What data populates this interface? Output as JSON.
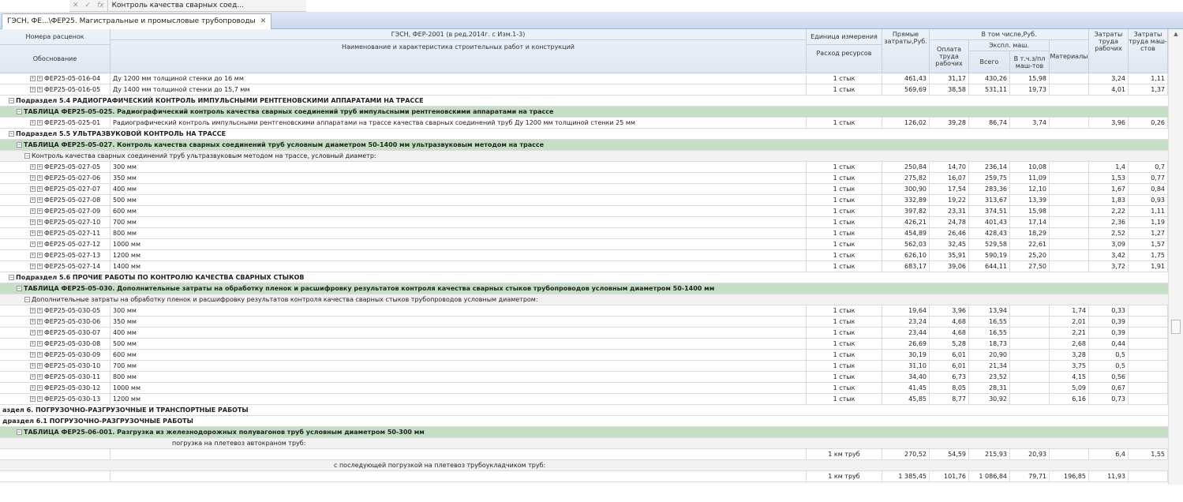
{
  "formula_bar": {
    "cancel": "✕",
    "confirm": "✓",
    "fx": "fx",
    "text": "Контроль качества сварных соед..."
  },
  "tab": {
    "label": "ГЭСН, ФЕ...\\ФЕР25. Магистральные и промысловые трубопроводы",
    "close": "✕"
  },
  "header": {
    "code_top": "Номера расценок",
    "code_bottom": "Обоснование",
    "title": "ГЭСН, ФЕР-2001 (в ред.2014г. с Изм.1-3)",
    "name": "Наименование и характеристика строительных работ и конструкций",
    "unit_top": "Единица измерения",
    "unit_bottom": "Расход ресурсов",
    "direct": "Прямые затраты,Руб.",
    "incl": "В том числе,Руб.",
    "pay": "Оплата труда рабочих",
    "mach": "Экспл. маш.",
    "mach_total": "Всего",
    "mach_incl": "В т.ч.з/пл маш-тов",
    "materials": "Материалы",
    "labor": "Затраты труда рабочих",
    "labor_mach": "Затраты труда маш-стов"
  },
  "rows": [
    {
      "type": "item",
      "code": "ФЕР25-05-016-04",
      "name": "Ду 1200 мм толщиной стенки до 16 мм",
      "unit": "1 стык",
      "v": [
        "461,43",
        "31,17",
        "430,26",
        "15,98",
        "",
        "3,24",
        "1,11"
      ]
    },
    {
      "type": "item",
      "code": "ФЕР25-05-016-05",
      "name": "Ду 1400 мм толщиной стенки до 15,7 мм",
      "unit": "1 стык",
      "v": [
        "569,69",
        "38,58",
        "531,11",
        "19,73",
        "",
        "4,01",
        "1,37"
      ]
    },
    {
      "type": "section",
      "text": "Подраздел 5.4 РАДИОГРАФИЧЕСКИЙ КОНТРОЛЬ ИМПУЛЬСНЫМИ РЕНТГЕНОВСКИМИ АППАРАТАМИ НА ТРАССЕ"
    },
    {
      "type": "table",
      "text": "ТАБЛИЦА ФЕР25-05-025. Радиографический контроль качества сварных соединений труб импульсными рентгеновскими аппаратами на трассе"
    },
    {
      "type": "item",
      "code": "ФЕР25-05-025-01",
      "name": "Радиографический контроль импульсными рентгеновскими аппаратами на трассе качества сварных соединений труб Ду 1200 мм толщиной стенки 25 мм",
      "unit": "1 стык",
      "v": [
        "126,02",
        "39,28",
        "86,74",
        "3,74",
        "",
        "3,96",
        "0,26"
      ]
    },
    {
      "type": "section",
      "text": "Подраздел 5.5 УЛЬТРАЗВУКОВОЙ КОНТРОЛЬ НА ТРАССЕ"
    },
    {
      "type": "table",
      "text": "ТАБЛИЦА ФЕР25-05-027. Контроль качества сварных соединений труб условным диаметром 50-1400 мм ультразвуковым методом на трассе"
    },
    {
      "type": "group",
      "text": "Контроль качества сварных соединений труб ультразвуковым методом на трассе, условный диаметр:"
    },
    {
      "type": "item",
      "code": "ФЕР25-05-027-05",
      "name": "300 мм",
      "unit": "1 стык",
      "v": [
        "250,84",
        "14,70",
        "236,14",
        "10,08",
        "",
        "1,4",
        "0,7"
      ]
    },
    {
      "type": "item",
      "code": "ФЕР25-05-027-06",
      "name": "350 мм",
      "unit": "1 стык",
      "v": [
        "275,82",
        "16,07",
        "259,75",
        "11,09",
        "",
        "1,53",
        "0,77"
      ]
    },
    {
      "type": "item",
      "code": "ФЕР25-05-027-07",
      "name": "400 мм",
      "unit": "1 стык",
      "v": [
        "300,90",
        "17,54",
        "283,36",
        "12,10",
        "",
        "1,67",
        "0,84"
      ]
    },
    {
      "type": "item",
      "code": "ФЕР25-05-027-08",
      "name": "500 мм",
      "unit": "1 стык",
      "v": [
        "332,89",
        "19,22",
        "313,67",
        "13,39",
        "",
        "1,83",
        "0,93"
      ]
    },
    {
      "type": "item",
      "code": "ФЕР25-05-027-09",
      "name": "600 мм",
      "unit": "1 стык",
      "v": [
        "397,82",
        "23,31",
        "374,51",
        "15,98",
        "",
        "2,22",
        "1,11"
      ]
    },
    {
      "type": "item",
      "code": "ФЕР25-05-027-10",
      "name": "700 мм",
      "unit": "1 стык",
      "v": [
        "426,21",
        "24,78",
        "401,43",
        "17,14",
        "",
        "2,36",
        "1,19"
      ]
    },
    {
      "type": "item",
      "code": "ФЕР25-05-027-11",
      "name": "800 мм",
      "unit": "1 стык",
      "v": [
        "454,89",
        "26,46",
        "428,43",
        "18,29",
        "",
        "2,52",
        "1,27"
      ]
    },
    {
      "type": "item",
      "code": "ФЕР25-05-027-12",
      "name": "1000 мм",
      "unit": "1 стык",
      "v": [
        "562,03",
        "32,45",
        "529,58",
        "22,61",
        "",
        "3,09",
        "1,57"
      ]
    },
    {
      "type": "item",
      "code": "ФЕР25-05-027-13",
      "name": "1200 мм",
      "unit": "1 стык",
      "v": [
        "626,10",
        "35,91",
        "590,19",
        "25,20",
        "",
        "3,42",
        "1,75"
      ]
    },
    {
      "type": "item",
      "code": "ФЕР25-05-027-14",
      "name": "1400 мм",
      "unit": "1 стык",
      "v": [
        "683,17",
        "39,06",
        "644,11",
        "27,50",
        "",
        "3,72",
        "1,91"
      ]
    },
    {
      "type": "section",
      "text": "Подраздел 5.6 ПРОЧИЕ РАБОТЫ ПО КОНТРОЛЮ КАЧЕСТВА СВАРНЫХ СТЫКОВ"
    },
    {
      "type": "table",
      "text": "ТАБЛИЦА ФЕР25-05-030. Дополнительные затраты на обработку пленок и расшифровку результатов контроля качества сварных стыков трубопроводов условным диаметром 50-1400 мм"
    },
    {
      "type": "group",
      "text": "Дополнительные затраты на обработку пленок и расшифровку результатов контроля качества сварных стыков трубопроводов условным диаметром:"
    },
    {
      "type": "item",
      "code": "ФЕР25-05-030-05",
      "name": "300 мм",
      "unit": "1 стык",
      "v": [
        "19,64",
        "3,96",
        "13,94",
        "",
        "1,74",
        "0,33",
        ""
      ]
    },
    {
      "type": "item",
      "code": "ФЕР25-05-030-06",
      "name": "350 мм",
      "unit": "1 стык",
      "v": [
        "23,24",
        "4,68",
        "16,55",
        "",
        "2,01",
        "0,39",
        ""
      ]
    },
    {
      "type": "item",
      "code": "ФЕР25-05-030-07",
      "name": "400 мм",
      "unit": "1 стык",
      "v": [
        "23,44",
        "4,68",
        "16,55",
        "",
        "2,21",
        "0,39",
        ""
      ]
    },
    {
      "type": "item",
      "code": "ФЕР25-05-030-08",
      "name": "500 мм",
      "unit": "1 стык",
      "v": [
        "26,69",
        "5,28",
        "18,73",
        "",
        "2,68",
        "0,44",
        ""
      ]
    },
    {
      "type": "item",
      "code": "ФЕР25-05-030-09",
      "name": "600 мм",
      "unit": "1 стык",
      "v": [
        "30,19",
        "6,01",
        "20,90",
        "",
        "3,28",
        "0,5",
        ""
      ]
    },
    {
      "type": "item",
      "code": "ФЕР25-05-030-10",
      "name": "700 мм",
      "unit": "1 стык",
      "v": [
        "31,10",
        "6,01",
        "21,34",
        "",
        "3,75",
        "0,5",
        ""
      ]
    },
    {
      "type": "item",
      "code": "ФЕР25-05-030-11",
      "name": "800 мм",
      "unit": "1 стык",
      "v": [
        "34,40",
        "6,73",
        "23,52",
        "",
        "4,15",
        "0,56",
        ""
      ]
    },
    {
      "type": "item",
      "code": "ФЕР25-05-030-12",
      "name": "1000 мм",
      "unit": "1 стык",
      "v": [
        "41,45",
        "8,05",
        "28,31",
        "",
        "5,09",
        "0,67",
        ""
      ]
    },
    {
      "type": "item",
      "code": "ФЕР25-05-030-13",
      "name": "1200 мм",
      "unit": "1 стык",
      "v": [
        "45,85",
        "8,77",
        "30,92",
        "",
        "6,16",
        "0,73",
        ""
      ]
    },
    {
      "type": "section",
      "text": "аздел 6. ПОГРУЗОЧНО-РАЗГРУЗОЧНЫЕ И ТРАНСПОРТНЫЕ РАБОТЫ",
      "noindent": true
    },
    {
      "type": "section",
      "text": "драздел 6.1 ПОГРУЗОЧНО-РАЗГРУЗОЧНЫЕ РАБОТЫ",
      "noindent": true
    },
    {
      "type": "table",
      "text": "ТАБЛИЦА ФЕР25-06-001. Разгрузка из железнодорожных полувагонов труб условным диаметром 50-300 мм"
    },
    {
      "type": "group",
      "text": "погрузка на плетевоз автокраном труб:",
      "offset": 215,
      "notog": true
    },
    {
      "type": "item",
      "code": "",
      "name": "",
      "unit": "1 км труб",
      "v": [
        "270,52",
        "54,59",
        "215,93",
        "20,93",
        "",
        "6,4",
        "1,55"
      ]
    },
    {
      "type": "group",
      "text": "с последующей погрузкой на плетевоз трубоукладчиком труб:",
      "offset": 420,
      "notog": true
    },
    {
      "type": "item",
      "code": "",
      "name": "",
      "unit": "1 км труб",
      "v": [
        "1 385,45",
        "101,76",
        "1 086,84",
        "79,71",
        "196,85",
        "11,93",
        ""
      ]
    }
  ]
}
